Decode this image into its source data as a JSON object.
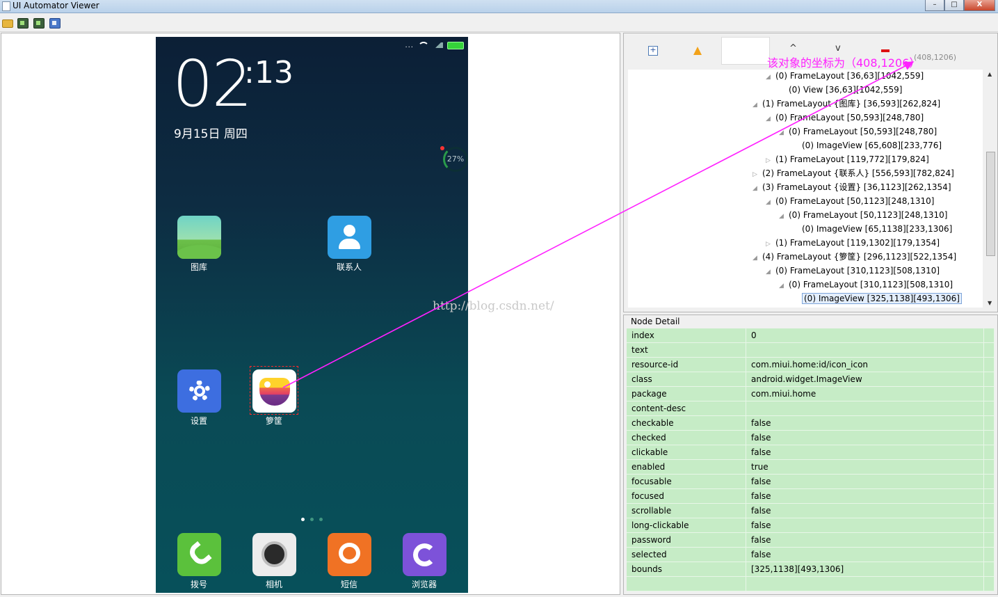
{
  "window": {
    "title": "UI Automator Viewer",
    "min_icon": "minimize-icon",
    "max_icon": "maximize-icon",
    "close_glyph": "X"
  },
  "toolbar": {
    "icons": [
      "open-folder-icon",
      "device-screenshot-icon",
      "device-screenshot-compressed-icon",
      "save-icon"
    ]
  },
  "phone": {
    "clock_hour": "02",
    "clock_minute": ":13",
    "date": "9月15日 周四",
    "cleaner_percent": "27%",
    "status_dots": "...",
    "apps": [
      {
        "label": "图库",
        "icon": "gallery-icon"
      },
      {
        "label": "联系人",
        "icon": "contacts-icon"
      },
      {
        "label": "设置",
        "icon": "settings-icon"
      },
      {
        "label": "箩筐",
        "icon": "basket-icon"
      }
    ],
    "dock": [
      {
        "label": "拨号",
        "icon": "phone-icon"
      },
      {
        "label": "相机",
        "icon": "camera-icon"
      },
      {
        "label": "短信",
        "icon": "sms-icon"
      },
      {
        "label": "浏览器",
        "icon": "browser-icon"
      }
    ],
    "pager": {
      "pages": 3,
      "current": 1
    }
  },
  "watermark": "http://blog.csdn.net/",
  "annotation": {
    "text": "该对象的坐标为（408,1206）",
    "coord": "(408,1206)",
    "color": "#ff20ff"
  },
  "tree": {
    "nodes": [
      {
        "text": "(0) FrameLayout [36,63][1042,559]",
        "arrow": "◢"
      },
      {
        "text": "(0) View [36,63][1042,559]",
        "arrow": ""
      },
      {
        "text": "(1) FrameLayout {图库} [36,593][262,824]",
        "arrow": "◢"
      },
      {
        "text": "(0) FrameLayout [50,593][248,780]",
        "arrow": "◢"
      },
      {
        "text": "(0) FrameLayout [50,593][248,780]",
        "arrow": "◢"
      },
      {
        "text": "(0) ImageView [65,608][233,776]",
        "arrow": ""
      },
      {
        "text": "(1) FrameLayout [119,772][179,824]",
        "arrow": "▷"
      },
      {
        "text": "(2) FrameLayout {联系人} [556,593][782,824]",
        "arrow": "▷"
      },
      {
        "text": "(3) FrameLayout {设置} [36,1123][262,1354]",
        "arrow": "◢"
      },
      {
        "text": "(0) FrameLayout [50,1123][248,1310]",
        "arrow": "◢"
      },
      {
        "text": "(0) FrameLayout [50,1123][248,1310]",
        "arrow": "◢"
      },
      {
        "text": "(0) ImageView [65,1138][233,1306]",
        "arrow": ""
      },
      {
        "text": "(1) FrameLayout [119,1302][179,1354]",
        "arrow": "▷"
      },
      {
        "text": "(4) FrameLayout {箩筐} [296,1123][522,1354]",
        "arrow": "◢"
      },
      {
        "text": "(0) FrameLayout [310,1123][508,1310]",
        "arrow": "◢"
      },
      {
        "text": "(0) FrameLayout [310,1123][508,1310]",
        "arrow": "◢"
      },
      {
        "text": "(0) ImageView [325,1138][493,1306]",
        "arrow": "",
        "selected": true
      }
    ]
  },
  "node_detail": {
    "title": "Node Detail",
    "rows": [
      {
        "key": "index",
        "value": "0"
      },
      {
        "key": "text",
        "value": ""
      },
      {
        "key": "resource-id",
        "value": "com.miui.home:id/icon_icon"
      },
      {
        "key": "class",
        "value": "android.widget.ImageView"
      },
      {
        "key": "package",
        "value": "com.miui.home"
      },
      {
        "key": "content-desc",
        "value": ""
      },
      {
        "key": "checkable",
        "value": "false"
      },
      {
        "key": "checked",
        "value": "false"
      },
      {
        "key": "clickable",
        "value": "false"
      },
      {
        "key": "enabled",
        "value": "true"
      },
      {
        "key": "focusable",
        "value": "false"
      },
      {
        "key": "focused",
        "value": "false"
      },
      {
        "key": "scrollable",
        "value": "false"
      },
      {
        "key": "long-clickable",
        "value": "false"
      },
      {
        "key": "password",
        "value": "false"
      },
      {
        "key": "selected",
        "value": "false"
      },
      {
        "key": "bounds",
        "value": "[325,1138][493,1306]"
      },
      {
        "key": "",
        "value": ""
      }
    ]
  }
}
